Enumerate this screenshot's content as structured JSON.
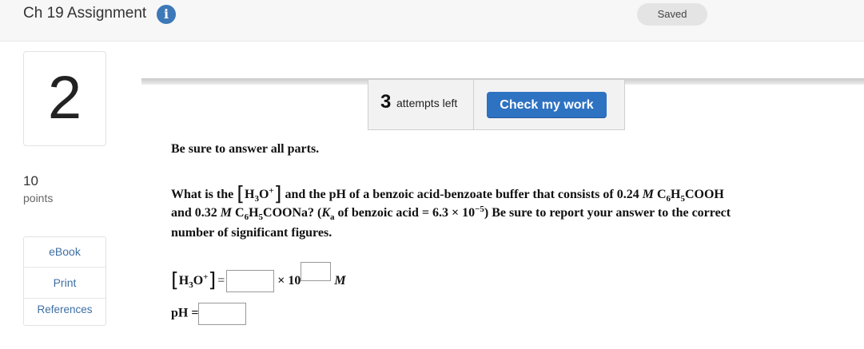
{
  "header": {
    "title": "Ch 19 Assignment",
    "info_icon": "info-icon",
    "saved_label": "Saved"
  },
  "question": {
    "number": "2",
    "points_value": "10",
    "points_label": "points",
    "side_links": [
      "eBook",
      "Print",
      "References"
    ]
  },
  "attempts": {
    "count": "3",
    "label": "attempts left"
  },
  "check_button": "Check my work",
  "content": {
    "instruction": "Be sure to answer all parts.",
    "q1_a": "What is the ",
    "q1_b": " and the pH of a benzoic acid-benzoate buffer that consists of 0.24 ",
    "q2_a": "and 0.32 ",
    "q2_b": " of benzoic acid = 6.3 × 10",
    "q2_c": ") Be sure to report your answer to the correct",
    "q3": "number of significant figures.",
    "times_ten": "× 10",
    "unit_M": "M",
    "ph_label": "pH ="
  },
  "colors": {
    "accent": "#2e72c2",
    "info": "#3d78b8",
    "link": "#3d6fa4"
  }
}
